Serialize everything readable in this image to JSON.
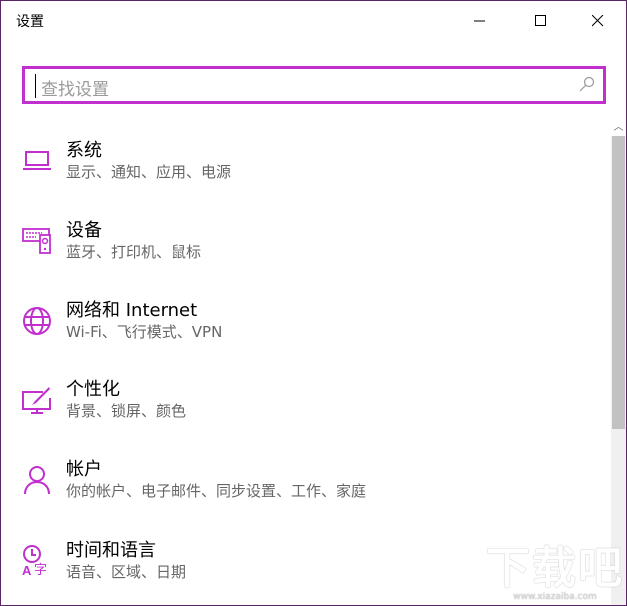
{
  "window": {
    "title": "设置",
    "minimize_label": "最小化",
    "maximize_label": "最大化",
    "close_label": "关闭"
  },
  "search": {
    "placeholder": "查找设置",
    "value": ""
  },
  "items": [
    {
      "title": "系统",
      "subtitle": "显示、通知、应用、电源",
      "icon": "laptop-icon"
    },
    {
      "title": "设备",
      "subtitle": "蓝牙、打印机、鼠标",
      "icon": "devices-icon"
    },
    {
      "title": "网络和 Internet",
      "subtitle": "Wi-Fi、飞行模式、VPN",
      "icon": "globe-icon"
    },
    {
      "title": "个性化",
      "subtitle": "背景、锁屏、颜色",
      "icon": "personalization-icon"
    },
    {
      "title": "帐户",
      "subtitle": "你的帐户、电子邮件、同步设置、工作、家庭",
      "icon": "person-icon"
    },
    {
      "title": "时间和语言",
      "subtitle": "语音、区域、日期",
      "icon": "time-language-icon"
    }
  ],
  "watermark": {
    "logo": "下载吧",
    "url": "www.xiazaiba.com"
  },
  "colors": {
    "accent": "#c12fcf",
    "border": "#5b2466"
  }
}
